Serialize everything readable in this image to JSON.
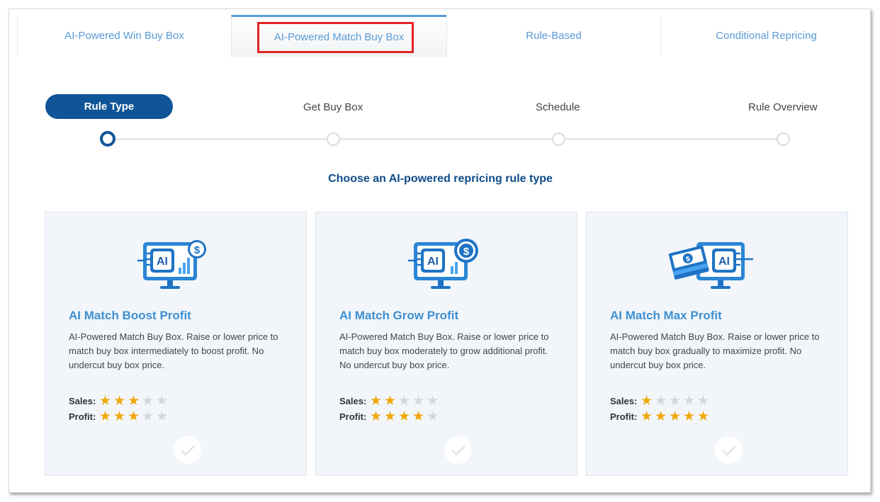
{
  "tabs": [
    {
      "label": "AI-Powered Win Buy Box"
    },
    {
      "label": "AI-Powered Match Buy Box"
    },
    {
      "label": "Rule-Based"
    },
    {
      "label": "Conditional Repricing"
    }
  ],
  "stepper": {
    "steps": [
      {
        "label": "Rule Type"
      },
      {
        "label": "Get Buy Box"
      },
      {
        "label": "Schedule"
      },
      {
        "label": "Rule Overview"
      }
    ]
  },
  "subtitle": "Choose an AI-powered repricing rule type",
  "colors": {
    "accent": "#0f5597",
    "link": "#5a9bd6",
    "star": "#f0a80a",
    "highlight": "#e32323"
  },
  "cards": [
    {
      "icon": "ai-monitor-dollar-chart-icon",
      "title": "AI Match Boost Profit",
      "description": "AI-Powered Match Buy Box. Raise or lower price to match buy box intermediately to boost profit. No undercut buy box price.",
      "sales_label": "Sales:",
      "profit_label": "Profit:",
      "sales_stars": 3,
      "profit_stars": 3
    },
    {
      "icon": "ai-monitor-dollar-coin-icon",
      "title": "AI Match Grow Profit",
      "description": "AI-Powered Match Buy Box. Raise or lower price to match buy box moderately to grow additional profit. No undercut buy box price.",
      "sales_label": "Sales:",
      "profit_label": "Profit:",
      "sales_stars": 2,
      "profit_stars": 4
    },
    {
      "icon": "ai-monitor-cash-stack-icon",
      "title": "AI Match Max Profit",
      "description": "AI-Powered Match Buy Box. Raise or lower price to match buy box gradually to maximize profit. No undercut buy box price.",
      "sales_label": "Sales:",
      "profit_label": "Profit:",
      "sales_stars": 1,
      "profit_stars": 5
    }
  ]
}
